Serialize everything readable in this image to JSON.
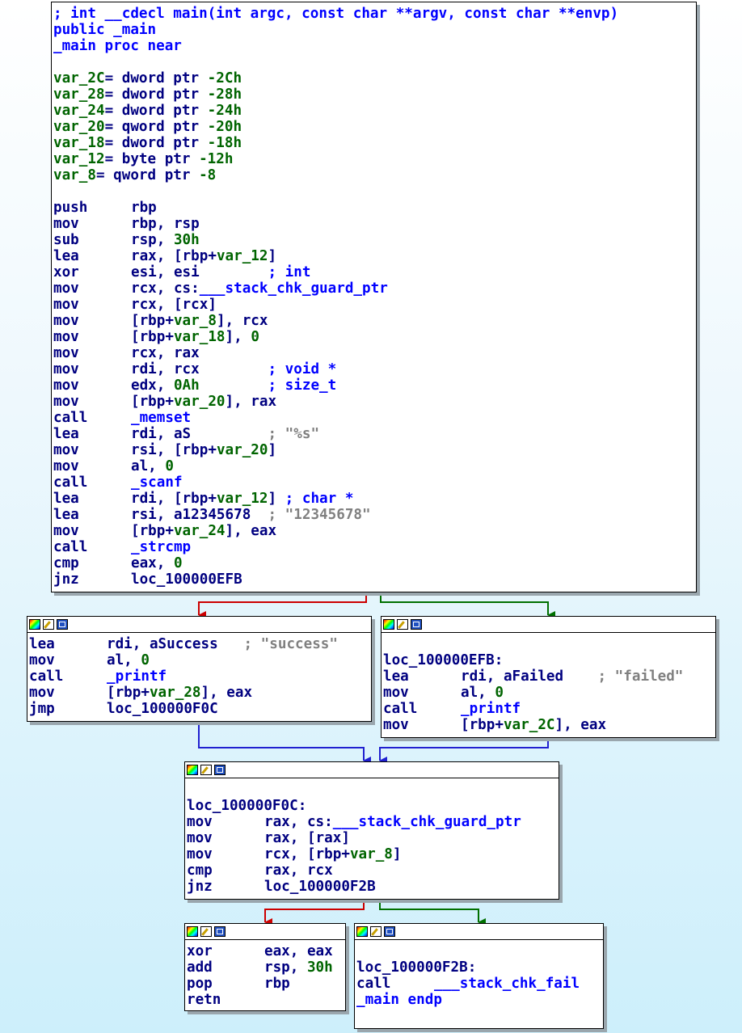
{
  "main_block": {
    "header": [
      "; int __cdecl main(int argc, const char **argv, const char **envp)",
      "public _main",
      "_main proc near"
    ],
    "vars": [
      {
        "name": "var_2C",
        "def": "= dword ptr -2Ch"
      },
      {
        "name": "var_28",
        "def": "= dword ptr -28h"
      },
      {
        "name": "var_24",
        "def": "= dword ptr -24h"
      },
      {
        "name": "var_20",
        "def": "= qword ptr -20h"
      },
      {
        "name": "var_18",
        "def": "= dword ptr -18h"
      },
      {
        "name": "var_12",
        "def": "= byte ptr -12h"
      },
      {
        "name": "var_8",
        "def": "= qword ptr -8"
      }
    ],
    "instructions": [
      {
        "mn": "push",
        "ops": "rbp",
        "cmt": ""
      },
      {
        "mn": "mov",
        "ops": "rbp, rsp",
        "cmt": ""
      },
      {
        "mn": "sub",
        "ops": "rsp, 30h",
        "cmt": ""
      },
      {
        "mn": "lea",
        "ops": "rax, [rbp+var_12]",
        "cmt": ""
      },
      {
        "mn": "xor",
        "ops": "esi, esi",
        "cmt": "        ; int"
      },
      {
        "mn": "mov",
        "ops": "rcx, cs:___stack_chk_guard_ptr",
        "cmt": ""
      },
      {
        "mn": "mov",
        "ops": "rcx, [rcx]",
        "cmt": ""
      },
      {
        "mn": "mov",
        "ops": "[rbp+var_8], rcx",
        "cmt": ""
      },
      {
        "mn": "mov",
        "ops": "[rbp+var_18], 0",
        "cmt": ""
      },
      {
        "mn": "mov",
        "ops": "rcx, rax",
        "cmt": ""
      },
      {
        "mn": "mov",
        "ops": "rdi, rcx",
        "cmt": "        ; void *"
      },
      {
        "mn": "mov",
        "ops": "edx, 0Ah",
        "cmt": "        ; size_t"
      },
      {
        "mn": "mov",
        "ops": "[rbp+var_20], rax",
        "cmt": ""
      },
      {
        "mn": "call",
        "ops": "_memset",
        "cmt": ""
      },
      {
        "mn": "lea",
        "ops": "rdi, aS",
        "cmt": "         ; \"%s\""
      },
      {
        "mn": "mov",
        "ops": "rsi, [rbp+var_20]",
        "cmt": ""
      },
      {
        "mn": "mov",
        "ops": "al, 0",
        "cmt": ""
      },
      {
        "mn": "call",
        "ops": "_scanf",
        "cmt": ""
      },
      {
        "mn": "lea",
        "ops": "rdi, [rbp+var_12]",
        "cmt": " ; char *"
      },
      {
        "mn": "lea",
        "ops": "rsi, a12345678",
        "cmt": "  ; \"12345678\""
      },
      {
        "mn": "mov",
        "ops": "[rbp+var_24], eax",
        "cmt": ""
      },
      {
        "mn": "call",
        "ops": "_strcmp",
        "cmt": ""
      },
      {
        "mn": "cmp",
        "ops": "eax, 0",
        "cmt": ""
      },
      {
        "mn": "jnz",
        "ops": "loc_100000EFB",
        "cmt": ""
      }
    ]
  },
  "success_block": {
    "instructions": [
      {
        "mn": "lea",
        "ops": "rdi, aSuccess",
        "cmt": "   ; \"success\""
      },
      {
        "mn": "mov",
        "ops": "al, 0",
        "cmt": ""
      },
      {
        "mn": "call",
        "ops": "_printf",
        "cmt": ""
      },
      {
        "mn": "mov",
        "ops": "[rbp+var_28], eax",
        "cmt": ""
      },
      {
        "mn": "jmp",
        "ops": "loc_100000F0C",
        "cmt": ""
      }
    ]
  },
  "failed_block": {
    "label": "loc_100000EFB:",
    "instructions": [
      {
        "mn": "lea",
        "ops": "rdi, aFailed",
        "cmt": "    ; \"failed\""
      },
      {
        "mn": "mov",
        "ops": "al, 0",
        "cmt": ""
      },
      {
        "mn": "call",
        "ops": "_printf",
        "cmt": ""
      },
      {
        "mn": "mov",
        "ops": "[rbp+var_2C], eax",
        "cmt": ""
      }
    ]
  },
  "check_block": {
    "label": "loc_100000F0C:",
    "instructions": [
      {
        "mn": "mov",
        "ops": "rax, cs:___stack_chk_guard_ptr",
        "cmt": ""
      },
      {
        "mn": "mov",
        "ops": "rax, [rax]",
        "cmt": ""
      },
      {
        "mn": "mov",
        "ops": "rcx, [rbp+var_8]",
        "cmt": ""
      },
      {
        "mn": "cmp",
        "ops": "rax, rcx",
        "cmt": ""
      },
      {
        "mn": "jnz",
        "ops": "loc_100000F2B",
        "cmt": ""
      }
    ]
  },
  "ret_block": {
    "instructions": [
      {
        "mn": "xor",
        "ops": "eax, eax",
        "cmt": ""
      },
      {
        "mn": "add",
        "ops": "rsp, 30h",
        "cmt": ""
      },
      {
        "mn": "pop",
        "ops": "rbp",
        "cmt": ""
      },
      {
        "mn": "retn",
        "ops": "",
        "cmt": ""
      }
    ]
  },
  "fail_block": {
    "label": "loc_100000F2B:",
    "instructions": [
      {
        "mn": "call",
        "ops": "___stack_chk_fail",
        "cmt": ""
      }
    ],
    "footer": "_main endp"
  },
  "colors": {
    "true_edge": "#cc0000",
    "false_edge": "#007000",
    "uncond_edge": "#2020d0"
  }
}
